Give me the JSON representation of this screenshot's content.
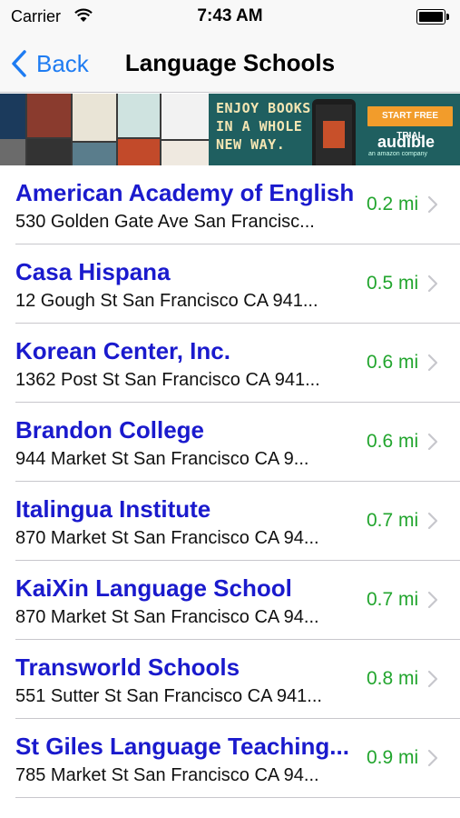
{
  "status_bar": {
    "carrier": "Carrier",
    "time": "7:43 AM",
    "icons": [
      "wifi-icon",
      "battery-icon"
    ]
  },
  "nav": {
    "back_label": "Back",
    "title": "Language Schools"
  },
  "ad": {
    "headline": "ENJOY BOOKS IN A WHOLE NEW WAY.",
    "line1": "ENJOY BOOKS",
    "line2": "IN A WHOLE",
    "line3": "NEW WAY.",
    "cta": "START FREE TRIAL",
    "brand": "audible",
    "brand_sub": "an amazon company"
  },
  "colors": {
    "title_blue": "#1a1acd",
    "distance_green": "#22a52e",
    "link_blue": "#1e7cf2",
    "separator": "#c8c7cc"
  },
  "schools": [
    {
      "name": "American Academy of English",
      "address": "530 Golden Gate Ave San Francisc...",
      "distance": "0.2 mi"
    },
    {
      "name": "Casa Hispana",
      "address": "12 Gough St San Francisco CA 941...",
      "distance": "0.5 mi"
    },
    {
      "name": "Korean Center, Inc.",
      "address": "1362 Post St San Francisco CA 941...",
      "distance": "0.6 mi"
    },
    {
      "name": "Brandon College",
      "address": "944 Market St San Francisco CA 9...",
      "distance": "0.6 mi"
    },
    {
      "name": "Italingua Institute",
      "address": "870 Market St San Francisco CA 94...",
      "distance": "0.7 mi"
    },
    {
      "name": "KaiXin Language School",
      "address": "870 Market St San Francisco CA 94...",
      "distance": "0.7 mi"
    },
    {
      "name": "Transworld Schools",
      "address": "551 Sutter St San Francisco CA 941...",
      "distance": "0.8 mi"
    },
    {
      "name": "St Giles Language Teaching...",
      "address": "785 Market St San Francisco CA 94...",
      "distance": "0.9 mi"
    }
  ]
}
